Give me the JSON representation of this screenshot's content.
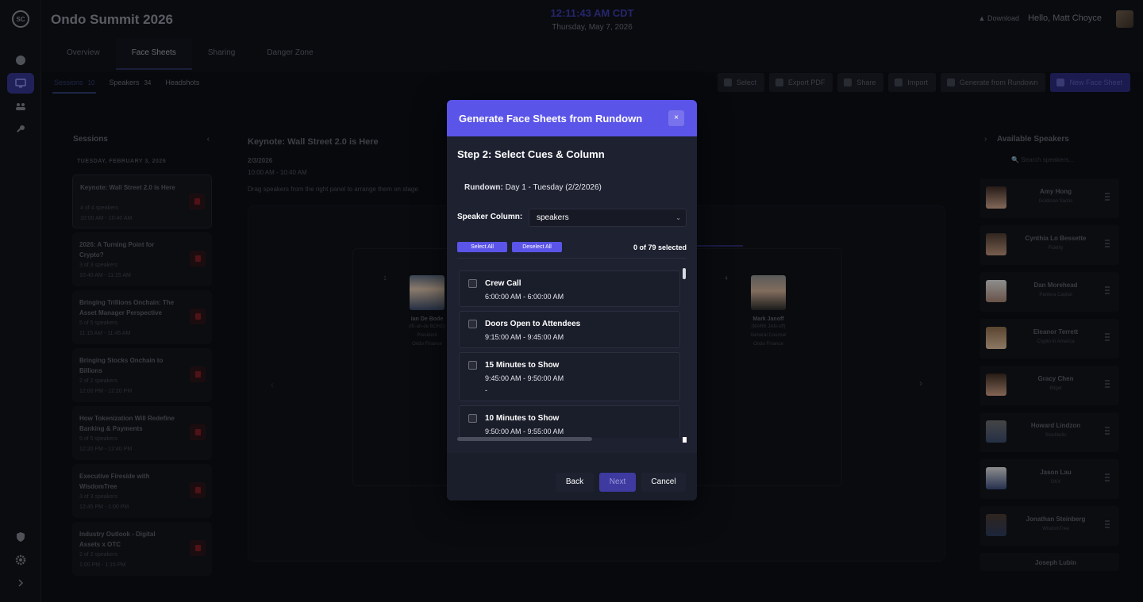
{
  "app": {
    "title": "Ondo Summit 2026",
    "clock": "12:11:43 AM CDT",
    "date": "Thursday, May 7, 2026",
    "download": "Download",
    "greeting": "Hello, Matt Choyce"
  },
  "nav_tabs": [
    "Overview",
    "Face Sheets",
    "Sharing",
    "Danger Zone"
  ],
  "sub_tabs": [
    {
      "label": "Sessions",
      "count": "10"
    },
    {
      "label": "Speakers",
      "count": "34"
    },
    {
      "label": "Headshots",
      "count": ""
    }
  ],
  "actions": [
    "Select",
    "Export PDF",
    "Share",
    "Import",
    "Generate from Rundown",
    "New Face Sheet"
  ],
  "sessions_panel": {
    "title": "Sessions",
    "day": "TUESDAY, FEBRUARY 3, 2026",
    "items": [
      {
        "title": "Keynote: Wall Street 2.0 is Here",
        "speakers": "4 of 4 speakers",
        "time": "10:00 AM - 10:40 AM"
      },
      {
        "title": "2026: A Turning Point for Crypto?",
        "speakers": "3 of 3 speakers",
        "time": "10:40 AM - 11:15 AM"
      },
      {
        "title": "Bringing Trillions Onchain: The Asset Manager Perspective",
        "speakers": "5 of 5 speakers",
        "time": "11:15 AM - 11:45 AM"
      },
      {
        "title": "Bringing Stocks Onchain to Billions",
        "speakers": "2 of 2 speakers",
        "time": "12:00 PM - 12:20 PM"
      },
      {
        "title": "How Tokenization Will Redefine Banking & Payments",
        "speakers": "5 of 5 speakers",
        "time": "12:20 PM - 12:40 PM"
      },
      {
        "title": "Executive Fireside with WisdomTree",
        "speakers": "3 of 3 speakers",
        "time": "12:45 PM - 1:00 PM"
      },
      {
        "title": "Industry Outlook - Digital Assets x OTC",
        "speakers": "2 of 2 speakers",
        "time": "1:00 PM - 1:15 PM"
      }
    ]
  },
  "center": {
    "title": "Keynote: Wall Street 2.0 is Here",
    "date": "2/3/2026",
    "time": "10:00 AM - 10:40 AM",
    "hint": "Drag speakers from the right panel to arrange them on stage",
    "slots": [
      {
        "num": "1",
        "name": "Ian De Bode",
        "line1": "(IE-un-de BOHD)",
        "role": "President",
        "org": "Ondo Finance"
      },
      {
        "num": "4",
        "name": "Mark Janoff",
        "line1": "(MARK JAN-off)",
        "role": "General Counsel",
        "org": "Ondo Finance"
      }
    ]
  },
  "speakers_panel": {
    "title": "Available Speakers",
    "search_placeholder": "Search speakers...",
    "items": [
      {
        "name": "Amy Hong",
        "company": "Goldman Sachs"
      },
      {
        "name": "Cynthia Lo Bessette",
        "company": "Fidelity"
      },
      {
        "name": "Dan Morehead",
        "company": "Pantera Capital"
      },
      {
        "name": "Eleanor Terrett",
        "company": "Crypto in America"
      },
      {
        "name": "Gracy Chen",
        "company": "Bitget"
      },
      {
        "name": "Howard Lindzon",
        "company": "Stocktwits"
      },
      {
        "name": "Jason Lau",
        "company": "OKX"
      },
      {
        "name": "Jonathan Steinberg",
        "company": "WisdomTree"
      },
      {
        "name": "Joseph Lubin",
        "company": ""
      }
    ]
  },
  "modal": {
    "title": "Generate Face Sheets from Rundown",
    "close": "×",
    "step": "Step 2: Select Cues & Column",
    "rundown_label": "Rundown:",
    "rundown_value": "Day 1 - Tuesday (2/2/2026)",
    "speaker_column_label": "Speaker Column:",
    "speaker_column_value": "speakers",
    "select_all": "Select All",
    "deselect_all": "Deselect All",
    "selected_count": "0 of 79 selected",
    "cues": [
      {
        "name": "Crew Call",
        "time": "6:00:00 AM - 6:00:00 AM",
        "extra": ""
      },
      {
        "name": "Doors Open to Attendees",
        "time": "9:15:00 AM - 9:45:00 AM",
        "extra": ""
      },
      {
        "name": "15 Minutes to Show",
        "time": "9:45:00 AM - 9:50:00 AM",
        "extra": "-"
      },
      {
        "name": "10 Minutes to Show",
        "time": "9:50:00 AM - 9:55:00 AM",
        "extra": ""
      }
    ],
    "back": "Back",
    "next": "Next",
    "cancel": "Cancel"
  }
}
